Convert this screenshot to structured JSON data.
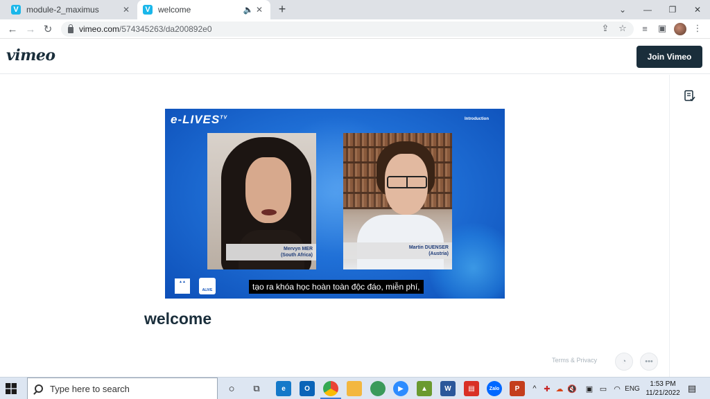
{
  "browser": {
    "tabs": [
      {
        "title": "module-2_maximus",
        "favicon": "V",
        "active": false
      },
      {
        "title": "welcome",
        "favicon": "V",
        "active": true
      }
    ],
    "new_tab_label": "+",
    "url_host": "vimeo.com",
    "url_path": "/574345263/da200892e0"
  },
  "site": {
    "logo": "vimeo",
    "join_label": "Join Vimeo"
  },
  "video": {
    "brand": "e-LIVES",
    "brand_tm": "TV",
    "section": "Introduction",
    "speaker_left_name": "Mervyn MER",
    "speaker_left_country": "(South Africa)",
    "speaker_right_name": "Martin DUENSER",
    "speaker_right_country": "(Austria)",
    "logo_alive": "ALIVE",
    "subtitle": "tạo ra khóa học hoàn toàn độc đáo, miễn phí,",
    "title": "welcome"
  },
  "footer": {
    "terms": "Terms & Privacy"
  },
  "taskbar": {
    "search_placeholder": "Type here to search",
    "apps": [
      {
        "name": "edge",
        "label": "e",
        "color": "#1479c9"
      },
      {
        "name": "outlook",
        "label": "O",
        "color": "#0a64b8"
      },
      {
        "name": "chrome",
        "label": "",
        "color": "#dd4b39"
      },
      {
        "name": "explorer",
        "label": "",
        "color": "#f3b73f"
      },
      {
        "name": "maps",
        "label": "",
        "color": "#3a9a5b"
      },
      {
        "name": "zoom",
        "label": "",
        "color": "#2d8cff"
      },
      {
        "name": "chart-app",
        "label": "",
        "color": "#6a9a2f"
      },
      {
        "name": "word",
        "label": "W",
        "color": "#2b579a"
      },
      {
        "name": "pdf",
        "label": "",
        "color": "#d93025"
      },
      {
        "name": "zalo",
        "label": "Zalo",
        "color": "#0068ff"
      },
      {
        "name": "powerpoint",
        "label": "P",
        "color": "#c43e1c"
      }
    ],
    "language": "ENG",
    "time": "1:53 PM",
    "date": "11/21/2022"
  }
}
